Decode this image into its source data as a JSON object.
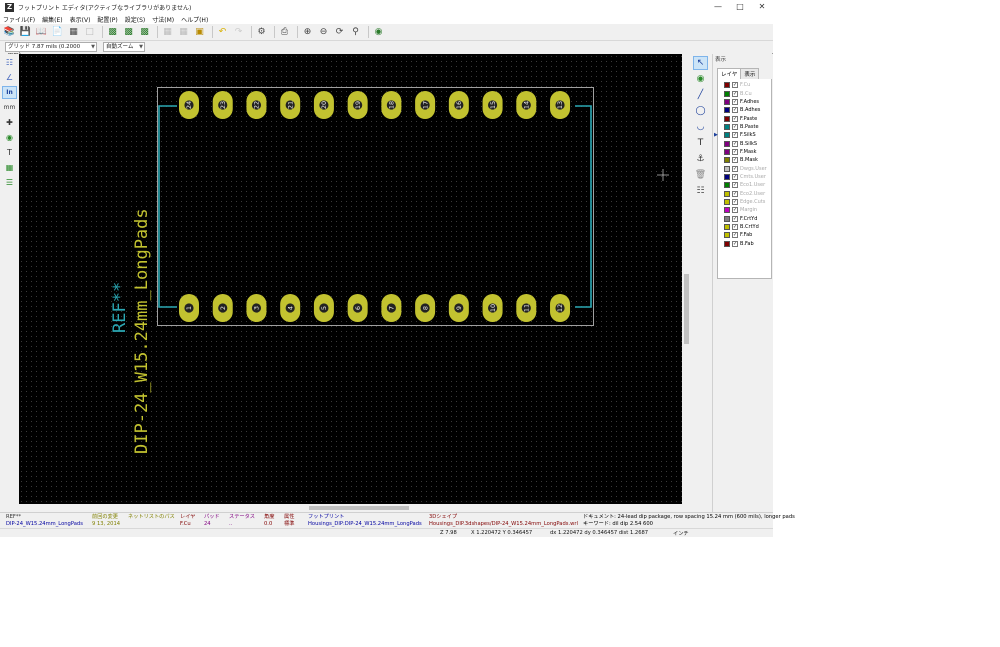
{
  "window": {
    "title": "フットプリント エディタ(アクティブなライブラリがありません)",
    "app_icon": "Z"
  },
  "menu": [
    "ファイル(F)",
    "編集(E)",
    "表示(V)",
    "配置(P)",
    "設定(S)",
    "寸法(M)",
    "ヘルプ(H)"
  ],
  "options": {
    "grid": "グリッド 7.87 mils (0.2000 mm)",
    "zoom": "自動ズーム"
  },
  "left_toolbar": {
    "units_label": "In",
    "mm_label": "mm"
  },
  "footprint": {
    "ref_text": "REF**",
    "value_text": "DIP-24_W15.24mm_LongPads",
    "top_pad_numbers": [
      "24",
      "23",
      "22",
      "21",
      "20",
      "19",
      "18",
      "17",
      "16",
      "15",
      "14",
      "13"
    ],
    "bottom_pad_numbers": [
      "1",
      "2",
      "3",
      "4",
      "5",
      "6",
      "7",
      "8",
      "9",
      "10",
      "11",
      "12"
    ]
  },
  "colors": {
    "canvas_bg": "#000000",
    "silkscreen": "#2ba7b3",
    "pad": "#c2c230",
    "value_text": "#c2c230",
    "courtyard": "#c8c8c8"
  },
  "layers_panel": {
    "header": "表示",
    "tabs": [
      "レイヤ",
      "表示"
    ],
    "active_layer": "F.SilkS",
    "layers": [
      {
        "name": "F.Cu",
        "color": "#800000",
        "checked": true,
        "dim": true
      },
      {
        "name": "B.Cu",
        "color": "#008000",
        "checked": true,
        "dim": true
      },
      {
        "name": "F.Adhes",
        "color": "#800080",
        "checked": true,
        "dim": false
      },
      {
        "name": "B.Adhes",
        "color": "#000080",
        "checked": true,
        "dim": false
      },
      {
        "name": "F.Paste",
        "color": "#800000",
        "checked": true,
        "dim": false
      },
      {
        "name": "B.Paste",
        "color": "#008080",
        "checked": true,
        "dim": false
      },
      {
        "name": "F.SilkS",
        "color": "#008080",
        "checked": true,
        "dim": false
      },
      {
        "name": "B.SilkS",
        "color": "#800080",
        "checked": true,
        "dim": false
      },
      {
        "name": "F.Mask",
        "color": "#800080",
        "checked": true,
        "dim": false
      },
      {
        "name": "B.Mask",
        "color": "#808000",
        "checked": true,
        "dim": false
      },
      {
        "name": "Dwgs.User",
        "color": "#c0c0c0",
        "checked": true,
        "dim": true
      },
      {
        "name": "Cmts.User",
        "color": "#000080",
        "checked": true,
        "dim": true
      },
      {
        "name": "Eco1.User",
        "color": "#008000",
        "checked": true,
        "dim": true
      },
      {
        "name": "Eco2.User",
        "color": "#c0c000",
        "checked": true,
        "dim": true
      },
      {
        "name": "Edge.Cuts",
        "color": "#c0c000",
        "checked": true,
        "dim": true
      },
      {
        "name": "Margin",
        "color": "#c000c0",
        "checked": true,
        "dim": true
      },
      {
        "name": "F.CrtYd",
        "color": "#808080",
        "checked": true,
        "dim": false
      },
      {
        "name": "B.CrtYd",
        "color": "#c0c000",
        "checked": true,
        "dim": false
      },
      {
        "name": "F.Fab",
        "color": "#c0c000",
        "checked": true,
        "dim": false
      },
      {
        "name": "B.Fab",
        "color": "#800000",
        "checked": true,
        "dim": false
      }
    ]
  },
  "message_panel": {
    "ref": {
      "label": "REF**",
      "value": "DIP-24_W15.24mm_LongPads"
    },
    "last_change": {
      "label": "前回の変更",
      "value": "9 13, 2014"
    },
    "netlist_path": {
      "label": "ネットリストのパス",
      "value": ""
    },
    "layer": {
      "label": "レイヤ",
      "value": "F.Cu"
    },
    "pads": {
      "label": "パッド",
      "value": "24"
    },
    "status": {
      "label": "ステータス",
      "value": ".."
    },
    "angle": {
      "label": "角度",
      "value": "0.0"
    },
    "attrib": {
      "label": "属性",
      "value": "標準"
    },
    "footprint": {
      "label": "フットプリント",
      "value": "Housings_DIP:DIP-24_W15.24mm_LongPads"
    },
    "shape3d": {
      "label": "3Dシェイプ",
      "value": "Housings_DIP.3dshapes/DIP-24_W15.24mm_LongPads.wrl"
    },
    "doc": "ドキュメント: 24-lead dip package, row spacing 15.24 mm (600 mils), longer pads",
    "keywords": "キーワード: dil dip 2.54 600"
  },
  "status_bar": {
    "zoom": "Z 7.98",
    "xy": "X 1.220472  Y 0.346457",
    "dxy": "dx 1.220472  dy 0.346457  dist 1.2687",
    "units": "インチ"
  }
}
